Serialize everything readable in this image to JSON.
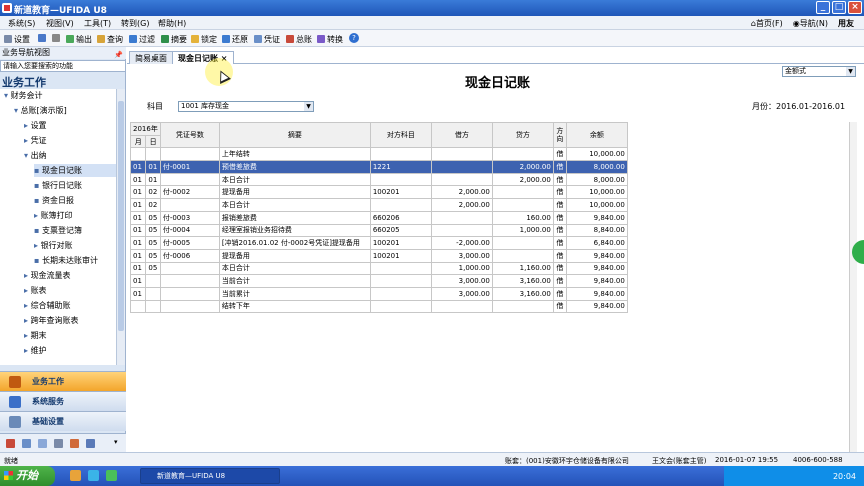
{
  "window": {
    "title": "新道教育—UFIDA U8"
  },
  "menu": [
    "系统(S)",
    "视图(V)",
    "工具(T)",
    "转到(G)",
    "帮助(H)"
  ],
  "menu_right": {
    "home": "首页(F)",
    "nav": "导航(N)",
    "brand": "用友"
  },
  "toolbar": [
    "设置",
    "输出",
    "查询",
    "过滤",
    "摘要",
    "锁定",
    "还原",
    "凭证",
    "总账",
    "转换"
  ],
  "sidebar": {
    "header": "业务导航视图",
    "search_placeholder": "请输入您要搜索的功能",
    "title": "业务工作",
    "tree": [
      {
        "label": "财务会计",
        "level": 0,
        "expander": "▾"
      },
      {
        "label": "总账[演示版]",
        "level": 1,
        "expander": "▾"
      },
      {
        "label": "设置",
        "level": 2,
        "expander": "▸"
      },
      {
        "label": "凭证",
        "level": 2,
        "expander": "▸"
      },
      {
        "label": "出纳",
        "level": 2,
        "expander": "▾"
      },
      {
        "label": "现金日记账",
        "level": 3,
        "expander": "",
        "selected": true
      },
      {
        "label": "银行日记账",
        "level": 3,
        "expander": ""
      },
      {
        "label": "资金日报",
        "level": 3,
        "expander": ""
      },
      {
        "label": "账簿打印",
        "level": 3,
        "expander": "▸"
      },
      {
        "label": "支票登记簿",
        "level": 3,
        "expander": ""
      },
      {
        "label": "银行对账",
        "level": 3,
        "expander": "▸"
      },
      {
        "label": "长期未达账审计",
        "level": 3,
        "expander": ""
      },
      {
        "label": "现金流量表",
        "level": 2,
        "expander": "▸"
      },
      {
        "label": "账表",
        "level": 2,
        "expander": "▸"
      },
      {
        "label": "综合辅助账",
        "level": 2,
        "expander": "▸"
      },
      {
        "label": "跨年查询账表",
        "level": 2,
        "expander": "▸"
      },
      {
        "label": "期末",
        "level": 2,
        "expander": "▸"
      },
      {
        "label": "维护",
        "level": 2,
        "expander": "▸"
      }
    ],
    "nav": [
      "业务工作",
      "系统服务",
      "基础设置"
    ]
  },
  "tabs": [
    {
      "label": "简易桌面"
    },
    {
      "label": "现金日记账",
      "close": "×"
    }
  ],
  "report": {
    "title": "现金日记账",
    "format": "金额式",
    "subject_label": "科目",
    "subject_value": "1001 库存现金",
    "period": "月份：2016.01-2016.01",
    "headers": {
      "year": "2016年",
      "month": "月",
      "day": "日",
      "voucher": "凭证号数",
      "summary": "摘要",
      "opposite": "对方科目",
      "debit": "借方",
      "credit": "贷方",
      "direction": "方向",
      "balance": "余额"
    },
    "rows": [
      [
        "",
        "",
        "",
        "上年结转",
        "",
        "",
        "",
        "借",
        "10,000.00"
      ],
      [
        "01",
        "01",
        "付-0001",
        "预借差旅费",
        "1221",
        "",
        "2,000.00",
        "借",
        "8,000.00"
      ],
      [
        "01",
        "01",
        "",
        "本日合计",
        "",
        "",
        "2,000.00",
        "借",
        "8,000.00"
      ],
      [
        "01",
        "02",
        "付-0002",
        "提现备用",
        "100201",
        "2,000.00",
        "",
        "借",
        "10,000.00"
      ],
      [
        "01",
        "02",
        "",
        "本日合计",
        "",
        "2,000.00",
        "",
        "借",
        "10,000.00"
      ],
      [
        "01",
        "05",
        "付-0003",
        "报销差旅费",
        "660206",
        "",
        "160.00",
        "借",
        "9,840.00"
      ],
      [
        "01",
        "05",
        "付-0004",
        "经理室报销业务招待费",
        "660205",
        "",
        "1,000.00",
        "借",
        "8,840.00"
      ],
      [
        "01",
        "05",
        "付-0005",
        "[冲销2016.01.02 付-0002号凭证]提现备用",
        "100201",
        "-2,000.00",
        "",
        "借",
        "6,840.00"
      ],
      [
        "01",
        "05",
        "付-0006",
        "提现备用",
        "100201",
        "3,000.00",
        "",
        "借",
        "9,840.00"
      ],
      [
        "01",
        "05",
        "",
        "本日合计",
        "",
        "1,000.00",
        "1,160.00",
        "借",
        "9,840.00"
      ],
      [
        "01",
        "",
        "",
        "当前合计",
        "",
        "3,000.00",
        "3,160.00",
        "借",
        "9,840.00"
      ],
      [
        "01",
        "",
        "",
        "当前累计",
        "",
        "3,000.00",
        "3,160.00",
        "借",
        "9,840.00"
      ],
      [
        "",
        "",
        "",
        "结转下年",
        "",
        "",
        "",
        "借",
        "9,840.00"
      ]
    ]
  },
  "status": {
    "left": "就绪",
    "account": "账套：(001)安徽环宇仓储设备有限公司",
    "user": "王文会(账套主管)",
    "datetime": "2016-01-07 19:55",
    "phone": "4006-600-588"
  },
  "taskbar": {
    "start": "开始",
    "task": "新道教育—UFIDA U8",
    "clock": "20:04"
  }
}
